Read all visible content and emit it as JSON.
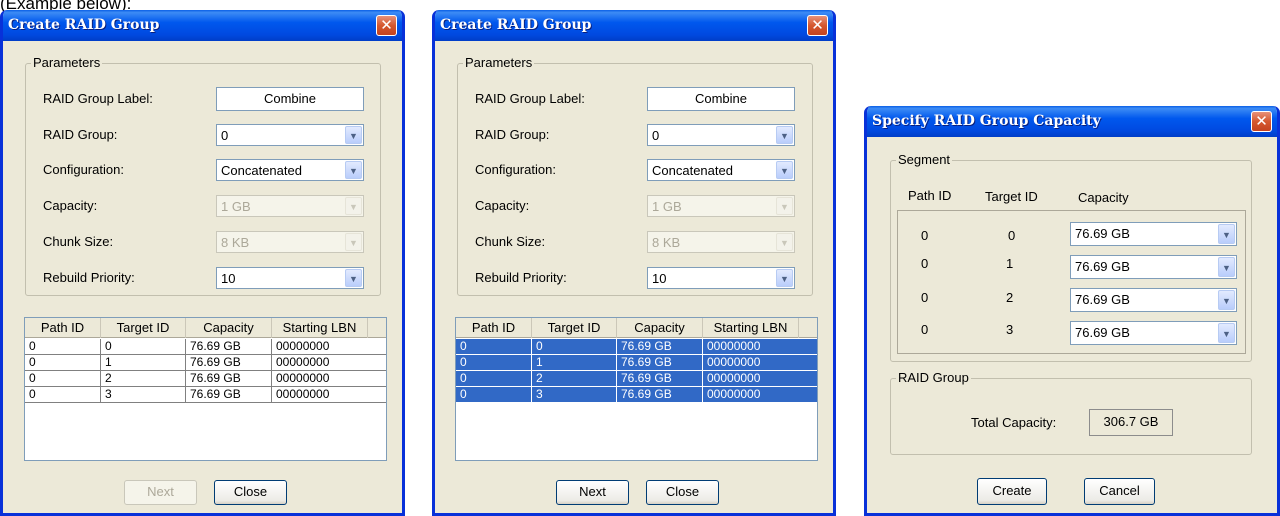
{
  "caption": "(Example below):",
  "colors": {
    "title_bar": "#0054e3",
    "selection": "#3169c6",
    "dialog_bg": "#ece9d8"
  },
  "dialog1": {
    "title": "Create RAID Group",
    "close_glyph": "✕",
    "parameters_legend": "Parameters",
    "labels": {
      "raid_group_label": "RAID Group Label:",
      "raid_group": "RAID Group:",
      "configuration": "Configuration:",
      "capacity": "Capacity:",
      "chunk_size": "Chunk Size:",
      "rebuild_priority": "Rebuild Priority:"
    },
    "values": {
      "raid_group_label": "Combine",
      "raid_group": "0",
      "configuration": "Concatenated",
      "capacity": "1 GB",
      "chunk_size": "8 KB",
      "rebuild_priority": "10"
    },
    "table": {
      "headers": [
        "Path ID",
        "Target ID",
        "Capacity",
        "Starting LBN"
      ],
      "rows": [
        [
          "0",
          "0",
          "76.69 GB",
          "00000000"
        ],
        [
          "0",
          "1",
          "76.69 GB",
          "00000000"
        ],
        [
          "0",
          "2",
          "76.69 GB",
          "00000000"
        ],
        [
          "0",
          "3",
          "76.69 GB",
          "00000000"
        ]
      ],
      "selected": false
    },
    "next_label": "Next",
    "next_enabled": false,
    "close_label": "Close"
  },
  "dialog2": {
    "title": "Create RAID Group",
    "close_glyph": "✕",
    "parameters_legend": "Parameters",
    "labels": {
      "raid_group_label": "RAID Group Label:",
      "raid_group": "RAID Group:",
      "configuration": "Configuration:",
      "capacity": "Capacity:",
      "chunk_size": "Chunk Size:",
      "rebuild_priority": "Rebuild Priority:"
    },
    "values": {
      "raid_group_label": "Combine",
      "raid_group": "0",
      "configuration": "Concatenated",
      "capacity": "1 GB",
      "chunk_size": "8 KB",
      "rebuild_priority": "10"
    },
    "table": {
      "headers": [
        "Path ID",
        "Target ID",
        "Capacity",
        "Starting LBN"
      ],
      "rows": [
        [
          "0",
          "0",
          "76.69 GB",
          "00000000"
        ],
        [
          "0",
          "1",
          "76.69 GB",
          "00000000"
        ],
        [
          "0",
          "2",
          "76.69 GB",
          "00000000"
        ],
        [
          "0",
          "3",
          "76.69 GB",
          "00000000"
        ]
      ],
      "selected": true
    },
    "next_label": "Next",
    "next_enabled": true,
    "close_label": "Close"
  },
  "dialog3": {
    "title": "Specify RAID Group Capacity",
    "close_glyph": "✕",
    "segment_legend": "Segment",
    "headers": [
      "Path ID",
      "Target ID",
      "Capacity"
    ],
    "rows": [
      {
        "path_id": "0",
        "target_id": "0",
        "capacity": "76.69 GB"
      },
      {
        "path_id": "0",
        "target_id": "1",
        "capacity": "76.69 GB"
      },
      {
        "path_id": "0",
        "target_id": "2",
        "capacity": "76.69 GB"
      },
      {
        "path_id": "0",
        "target_id": "3",
        "capacity": "76.69 GB"
      }
    ],
    "raid_group_legend": "RAID Group",
    "total_capacity_label": "Total Capacity:",
    "total_capacity_value": "306.7 GB",
    "create_label": "Create",
    "cancel_label": "Cancel"
  }
}
